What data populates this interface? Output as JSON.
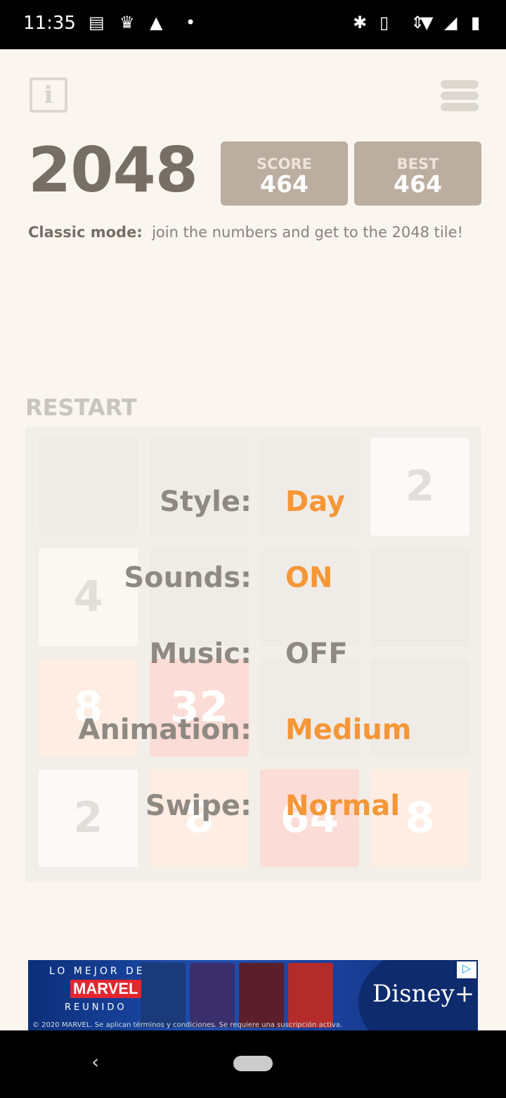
{
  "status_bar": {
    "time": "11:35",
    "icons": [
      "news-icon",
      "pet-icon",
      "warning-icon",
      "dot-icon",
      "cast-icon",
      "bluetooth-icon",
      "vibrate-icon",
      "data-arrows-icon",
      "wifi-icon",
      "signal-icon",
      "battery-charging-icon"
    ]
  },
  "header": {
    "info_icon": "info-icon",
    "menu_icon": "hamburger-menu-icon",
    "title": "2048",
    "score_label": "SCORE",
    "score": "464",
    "best_label": "BEST",
    "best": "464"
  },
  "subtitle": {
    "bold": "Classic mode:",
    "text": "join the numbers and get to the 2048 tile!"
  },
  "restart_label": "RESTART",
  "board": [
    [
      "",
      "",
      "",
      "2"
    ],
    [
      "4",
      "",
      "",
      ""
    ],
    [
      "8",
      "32",
      "",
      ""
    ],
    [
      "2",
      "8",
      "64",
      "8"
    ]
  ],
  "settings": [
    {
      "label": "Style:",
      "value": "Day",
      "color": "#f59637"
    },
    {
      "label": "Sounds:",
      "value": "ON",
      "color": "#f59637"
    },
    {
      "label": "Music:",
      "value": "OFF",
      "color": "#8f8983"
    },
    {
      "label": "Animation:",
      "value": "Medium",
      "color": "#f59637"
    },
    {
      "label": "Swipe:",
      "value": "Normal",
      "color": "#f59637"
    }
  ],
  "ad": {
    "line1": "LO MEJOR DE",
    "brand": "MARVEL",
    "line2": "REUNIDO",
    "logo": "Disney+",
    "copyright": "© 2020 MARVEL. Se aplican términos y condiciones. Se requiere una suscripción activa."
  },
  "nav": {
    "back": "‹"
  }
}
